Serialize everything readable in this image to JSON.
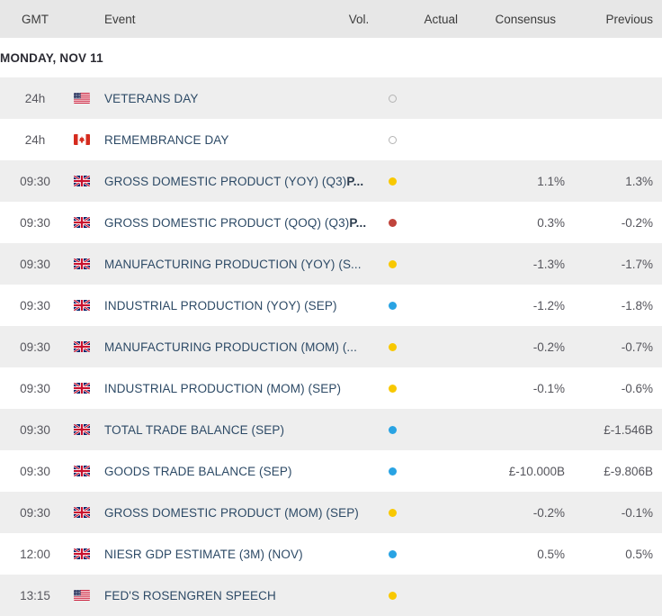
{
  "header": {
    "time": "GMT",
    "event": "Event",
    "vol": "Vol.",
    "actual": "Actual",
    "consensus": "Consensus",
    "previous": "Previous"
  },
  "date_group": {
    "label": "MONDAY, NOV 11"
  },
  "colors": {
    "header_bg": "#e7e7e7",
    "row_alt_bg": "#eeeeee",
    "row_bg": "#ffffff",
    "event_text": "#2d4a66",
    "value_text": "#55555c",
    "vol_high": "#c0443c",
    "vol_medium": "#f8c800",
    "vol_low": "#29a3e3",
    "vol_none": "#b3b3b3"
  },
  "rows": [
    {
      "time": "24h",
      "flag": "us-flag",
      "event": "VETERANS DAY",
      "event_suffix": "",
      "vol": "none",
      "actual": "",
      "consensus": "",
      "previous": ""
    },
    {
      "time": "24h",
      "flag": "ca-flag",
      "event": "REMEMBRANCE DAY",
      "event_suffix": "",
      "vol": "none",
      "actual": "",
      "consensus": "",
      "previous": ""
    },
    {
      "time": "09:30",
      "flag": "gb-flag",
      "event": "GROSS DOMESTIC PRODUCT (YOY) (Q3)",
      "event_suffix": "P...",
      "vol": "medium",
      "actual": "",
      "consensus": "1.1%",
      "previous": "1.3%"
    },
    {
      "time": "09:30",
      "flag": "gb-flag",
      "event": "GROSS DOMESTIC PRODUCT (QOQ) (Q3)",
      "event_suffix": "P...",
      "vol": "high",
      "actual": "",
      "consensus": "0.3%",
      "previous": "-0.2%"
    },
    {
      "time": "09:30",
      "flag": "gb-flag",
      "event": "MANUFACTURING PRODUCTION (YOY) (S...",
      "event_suffix": "",
      "vol": "medium",
      "actual": "",
      "consensus": "-1.3%",
      "previous": "-1.7%"
    },
    {
      "time": "09:30",
      "flag": "gb-flag",
      "event": "INDUSTRIAL PRODUCTION (YOY) (SEP)",
      "event_suffix": "",
      "vol": "low",
      "actual": "",
      "consensus": "-1.2%",
      "previous": "-1.8%"
    },
    {
      "time": "09:30",
      "flag": "gb-flag",
      "event": "MANUFACTURING PRODUCTION (MOM) (...",
      "event_suffix": "",
      "vol": "medium",
      "actual": "",
      "consensus": "-0.2%",
      "previous": "-0.7%"
    },
    {
      "time": "09:30",
      "flag": "gb-flag",
      "event": "INDUSTRIAL PRODUCTION (MOM) (SEP)",
      "event_suffix": "",
      "vol": "medium",
      "actual": "",
      "consensus": "-0.1%",
      "previous": "-0.6%"
    },
    {
      "time": "09:30",
      "flag": "gb-flag",
      "event": "TOTAL TRADE BALANCE (SEP)",
      "event_suffix": "",
      "vol": "low",
      "actual": "",
      "consensus": "",
      "previous": "£-1.546B"
    },
    {
      "time": "09:30",
      "flag": "gb-flag",
      "event": "GOODS TRADE BALANCE (SEP)",
      "event_suffix": "",
      "vol": "low",
      "actual": "",
      "consensus": "£-10.000B",
      "previous": "£-9.806B"
    },
    {
      "time": "09:30",
      "flag": "gb-flag",
      "event": "GROSS DOMESTIC PRODUCT (MOM) (SEP)",
      "event_suffix": "",
      "vol": "medium",
      "actual": "",
      "consensus": "-0.2%",
      "previous": "-0.1%"
    },
    {
      "time": "12:00",
      "flag": "gb-flag",
      "event": "NIESR GDP ESTIMATE (3M) (NOV)",
      "event_suffix": "",
      "vol": "low",
      "actual": "",
      "consensus": "0.5%",
      "previous": "0.5%"
    },
    {
      "time": "13:15",
      "flag": "us-flag",
      "event": "FED'S ROSENGREN SPEECH",
      "event_suffix": "",
      "vol": "medium",
      "actual": "",
      "consensus": "",
      "previous": ""
    }
  ]
}
